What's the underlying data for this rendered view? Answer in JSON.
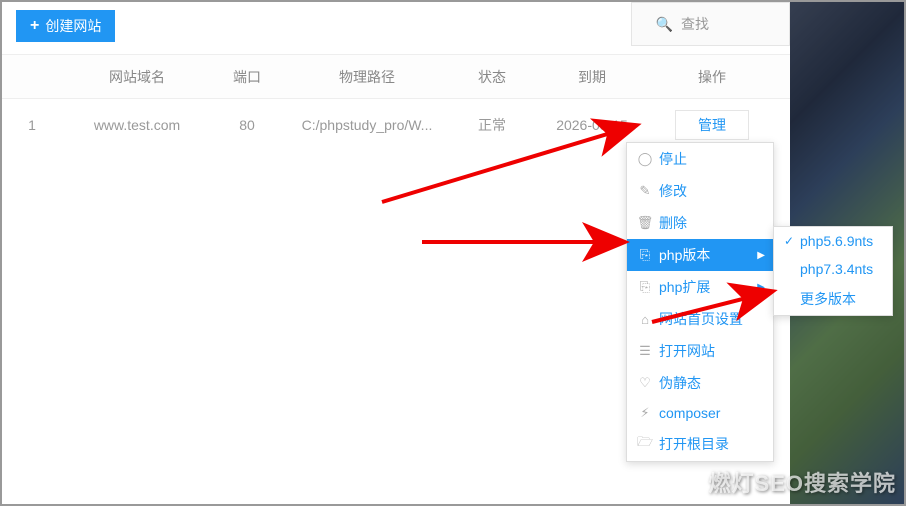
{
  "toolbar": {
    "create_label": "创建网站"
  },
  "search": {
    "placeholder": "查找"
  },
  "table": {
    "headers": {
      "domain": "网站域名",
      "port": "端口",
      "path": "物理路径",
      "status": "状态",
      "expire": "到期",
      "action": "操作"
    },
    "rows": [
      {
        "idx": "1",
        "domain": "www.test.com",
        "port": "80",
        "path": "C:/phpstudy_pro/W...",
        "status": "正常",
        "expire": "2026-05-15",
        "action": "管理"
      }
    ]
  },
  "dropdown": {
    "items": [
      {
        "icon": "◯",
        "label": "停止"
      },
      {
        "icon": "✎",
        "label": "修改"
      },
      {
        "icon": "🗑",
        "label": "删除"
      },
      {
        "icon": "⎘",
        "label": "php版本",
        "has_arrow": true,
        "highlight": true
      },
      {
        "icon": "⎘",
        "label": "php扩展",
        "has_arrow": true
      },
      {
        "icon": "⌂",
        "label": "网站首页设置"
      },
      {
        "icon": "☰",
        "label": "打开网站"
      },
      {
        "icon": "♡",
        "label": "伪静态"
      },
      {
        "icon": "⚡︎",
        "label": "composer"
      },
      {
        "icon": "🗁",
        "label": "打开根目录"
      }
    ]
  },
  "submenu": {
    "items": [
      {
        "label": "php5.6.9nts",
        "checked": true
      },
      {
        "label": "php7.3.4nts",
        "checked": false
      },
      {
        "label": "更多版本",
        "checked": false
      }
    ]
  },
  "watermark": "燃灯SEO搜索学院"
}
